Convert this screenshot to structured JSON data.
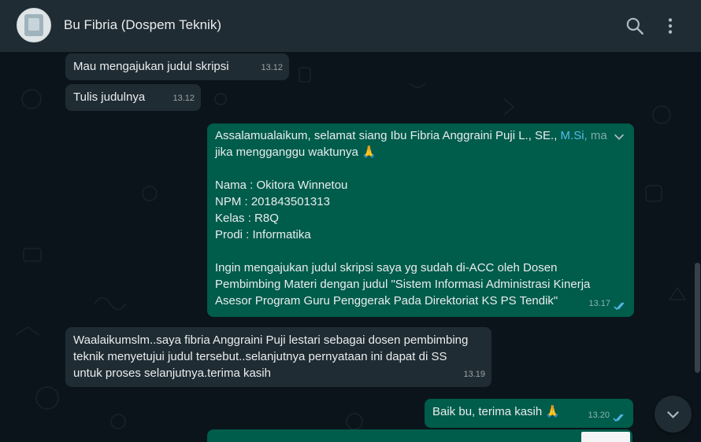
{
  "header": {
    "contact_name": "Bu Fibria (Dospem Teknik)",
    "search_icon": "search-icon",
    "menu_icon": "more-vertical-icon"
  },
  "messages": [
    {
      "dir": "in",
      "text": "Mau mengajukan judul skripsi",
      "time": "13.12"
    },
    {
      "dir": "in",
      "text": "Tulis judulnya",
      "time": "13.12"
    },
    {
      "dir": "out",
      "line1_pre": "Assalamualaikum, selamat siang Ibu Fibria Anggraini Puji L., SE., ",
      "line1_link": "M.Si",
      "line1_post": ", ma",
      "line2": "jika mengganggu waktunya 🙏",
      "nama": "Nama : Okitora Winnetou",
      "npm": "NPM : 201843501313",
      "kelas": "Kelas : R8Q",
      "prodi": "Prodi : Informatika",
      "body1": "Ingin mengajukan judul skripsi saya yg sudah di-ACC oleh Dosen",
      "body2": "Pembimbing Materi dengan judul \"Sistem Informasi Administrasi Kinerja",
      "body3": "Asesor Program Guru Penggerak Pada Direktoriat KS PS Tendik\"",
      "time": "13.17"
    },
    {
      "dir": "in",
      "l1": "Waalaikumslm..saya fibria Anggraini Puji lestari sebagai dosen pembimbing",
      "l2": "teknik menyetujui judul tersebut..selanjutnya pernyataan ini dapat di SS",
      "l3": "untuk proses selanjutnya.terima kasih",
      "time": "13.19"
    },
    {
      "dir": "out",
      "text": "Baik bu, terima kasih 🙏",
      "time": "13.20"
    }
  ],
  "colors": {
    "header_bg": "#202c33",
    "chat_bg": "#0b141a",
    "incoming_bubble": "#202c33",
    "outgoing_bubble": "#005c4b",
    "read_ticks": "#53bdeb"
  }
}
